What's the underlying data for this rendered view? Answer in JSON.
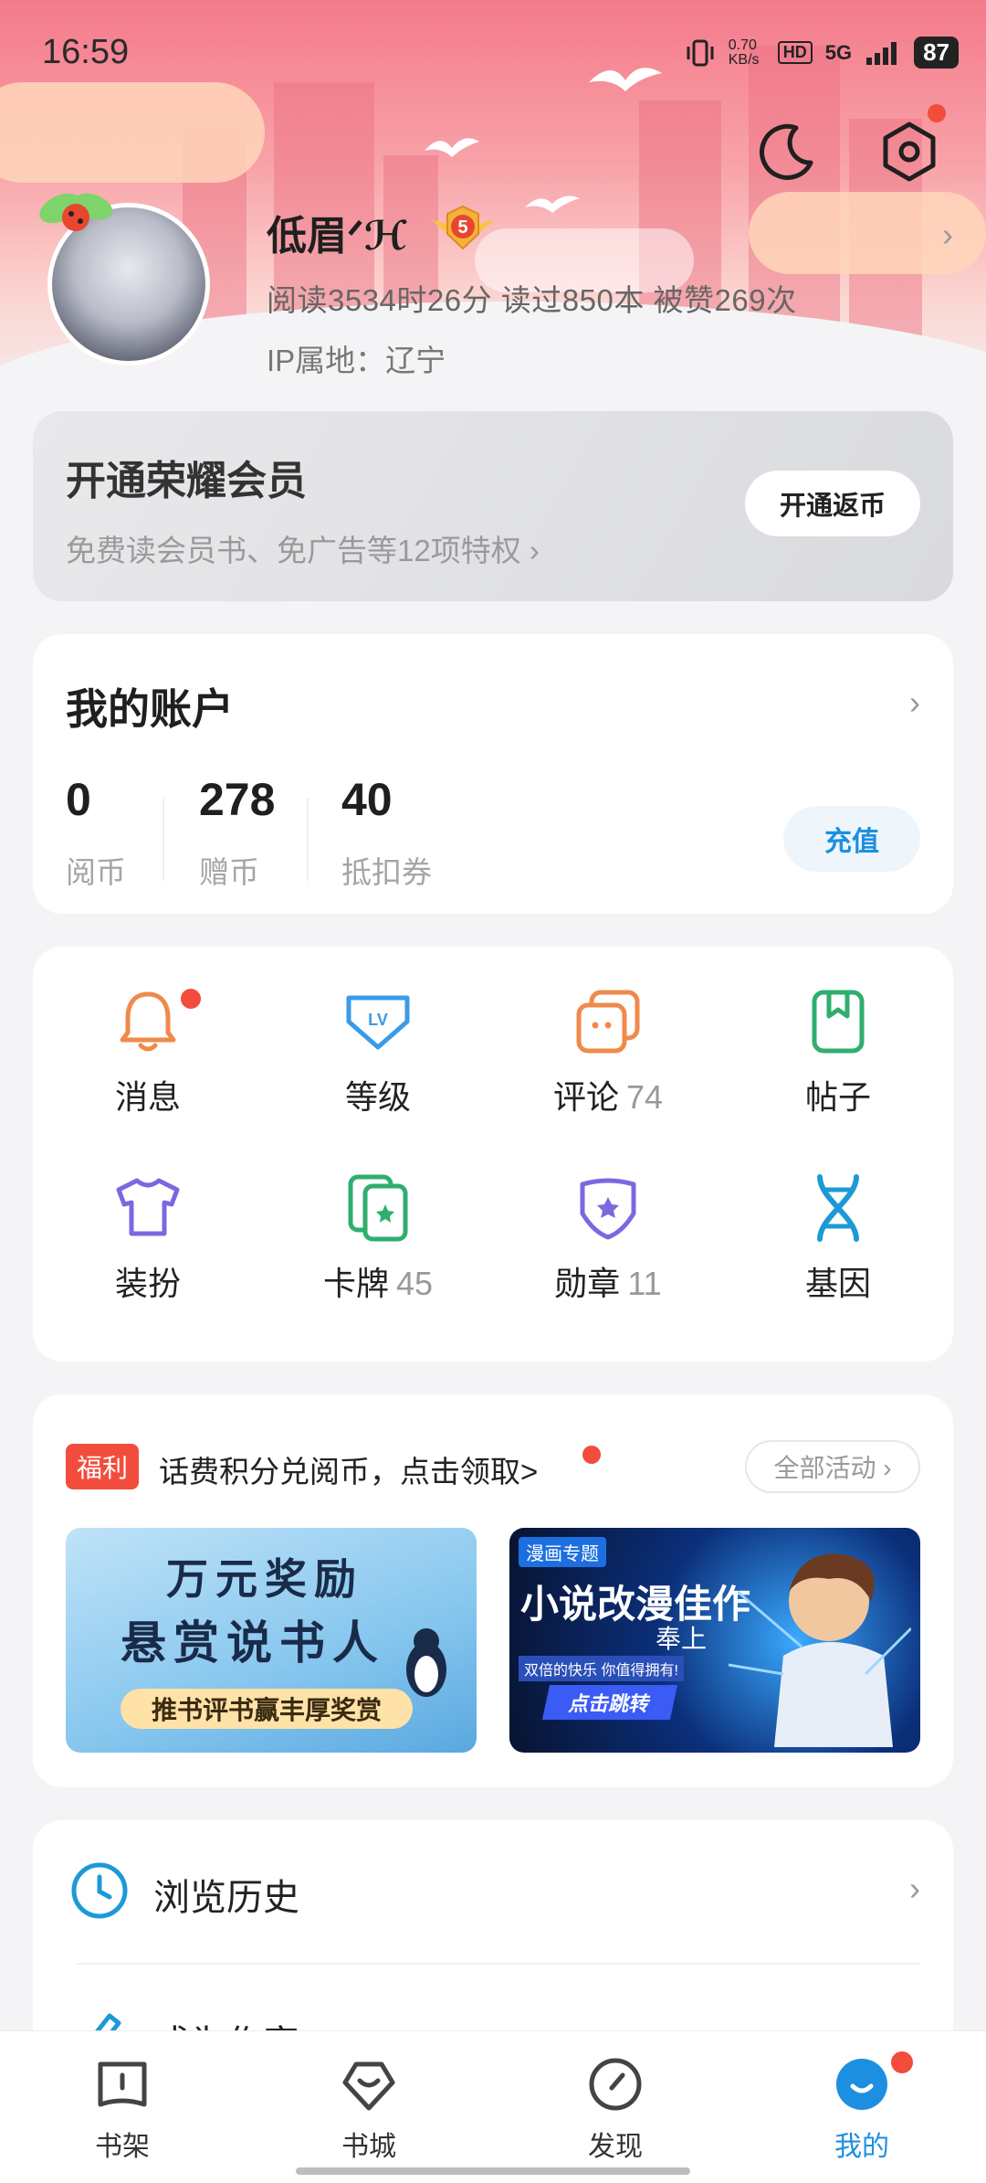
{
  "status_bar": {
    "time": "16:59",
    "net_speed": "0.70 KB/s",
    "hd": "HD",
    "signal": "5G",
    "battery": "87"
  },
  "profile": {
    "nickname": "低眉ᐟℋ",
    "level": "5",
    "stats": "阅读3534时26分  读过850本  被赞269次",
    "ip": "IP属地：辽宁"
  },
  "vip": {
    "title": "开通荣耀会员",
    "subtitle": "免费读会员书、免广告等12项特权 ›",
    "button": "开通返币"
  },
  "account": {
    "title": "我的账户",
    "items": [
      {
        "value": "0",
        "label": "阅币"
      },
      {
        "value": "278",
        "label": "赠币"
      },
      {
        "value": "40",
        "label": "抵扣券"
      }
    ],
    "recharge": "充值"
  },
  "grid": [
    {
      "label": "消息",
      "count": "",
      "icon": "bell-icon",
      "color": "#f08a4b"
    },
    {
      "label": "等级",
      "count": "",
      "icon": "level-shield-icon",
      "color": "#3a9be8"
    },
    {
      "label": "评论",
      "count": "74",
      "icon": "comment-icon",
      "color": "#f08a4b"
    },
    {
      "label": "帖子",
      "count": "",
      "icon": "bookmark-post-icon",
      "color": "#2fae6f"
    },
    {
      "label": "装扮",
      "count": "",
      "icon": "tshirt-icon",
      "color": "#7b68e0"
    },
    {
      "label": "卡牌",
      "count": "45",
      "icon": "card-icon",
      "color": "#2fae6f"
    },
    {
      "label": "勋章",
      "count": "11",
      "icon": "medal-icon",
      "color": "#7b68e0"
    },
    {
      "label": "基因",
      "count": "",
      "icon": "dna-icon",
      "color": "#1d9ad6"
    }
  ],
  "welfare": {
    "tag": "福利",
    "text": "话费积分兑阅币，点击领取>",
    "all": "全部活动 ›",
    "banner1": {
      "line1": "万元奖励",
      "line2": "悬赏说书人",
      "line3": "推书评书赢丰厚奖赏"
    },
    "banner2": {
      "tag": "漫画专题",
      "title": "小说改漫佳作",
      "sub": "奉上",
      "note": "双倍的快乐 你值得拥有!",
      "button": "点击跳转"
    }
  },
  "list": [
    {
      "label": "浏览历史"
    },
    {
      "label": "成为作家"
    }
  ],
  "tabs": [
    {
      "label": "书架",
      "icon": "bookshelf-icon"
    },
    {
      "label": "书城",
      "icon": "bookstore-icon"
    },
    {
      "label": "发现",
      "icon": "compass-icon"
    },
    {
      "label": "我的",
      "icon": "profile-icon"
    }
  ],
  "colors": {
    "accent": "#1d8fe0",
    "red_dot": "#f24c3d",
    "hero_pink": "#f47a8a"
  }
}
